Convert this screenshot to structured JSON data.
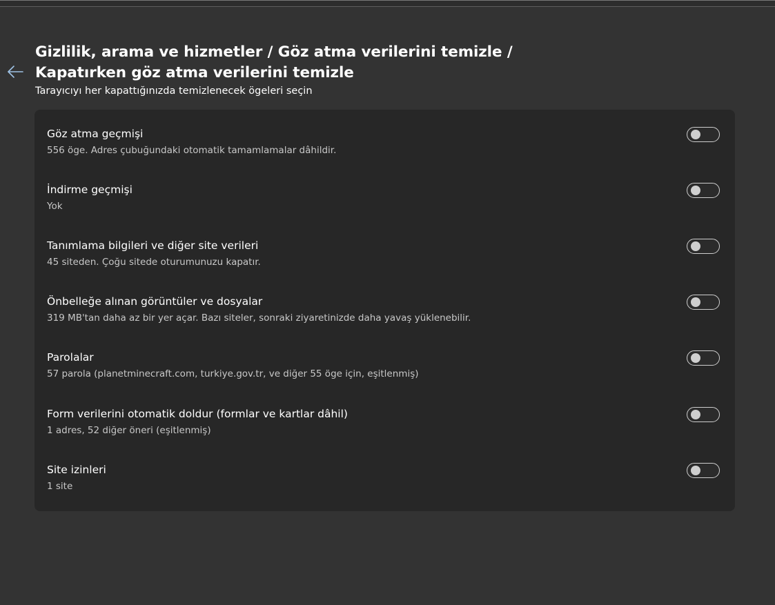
{
  "header": {
    "title_line1": "Gizlilik, arama ve hizmetler / Göz atma verilerini temizle /",
    "title_line2": "Kapatırken göz atma verilerini temizle",
    "subtitle": "Tarayıcıyı her kapattığınızda temizlenecek ögeleri seçin",
    "back_icon": "arrow-left-icon"
  },
  "options": [
    {
      "title": "Göz atma geçmişi",
      "description": "556 öge. Adres çubuğundaki otomatik tamamlamalar dâhildir.",
      "enabled": false
    },
    {
      "title": "İndirme geçmişi",
      "description": "Yok",
      "enabled": false
    },
    {
      "title": "Tanımlama bilgileri ve diğer site verileri",
      "description": "45 siteden. Çoğu sitede oturumunuzu kapatır.",
      "enabled": false
    },
    {
      "title": "Önbelleğe alınan görüntüler ve dosyalar",
      "description": "319 MB'tan daha az bir yer açar. Bazı siteler, sonraki ziyaretinizde daha yavaş yüklenebilir.",
      "enabled": false
    },
    {
      "title": "Parolalar",
      "description": "57 parola (planetminecraft.com, turkiye.gov.tr, ve diğer 55 öge için, eşitlenmiş)",
      "enabled": false
    },
    {
      "title": "Form verilerini otomatik doldur (formlar ve kartlar dâhil)",
      "description": "1 adres, 52 diğer öneri (eşitlenmiş)",
      "enabled": false
    },
    {
      "title": "Site izinleri",
      "description": "1 site",
      "enabled": false
    }
  ],
  "colors": {
    "background": "#333333",
    "card": "#272727",
    "accent_back_arrow": "#9fc3e6",
    "toggle_off": "#cfcfcf"
  }
}
